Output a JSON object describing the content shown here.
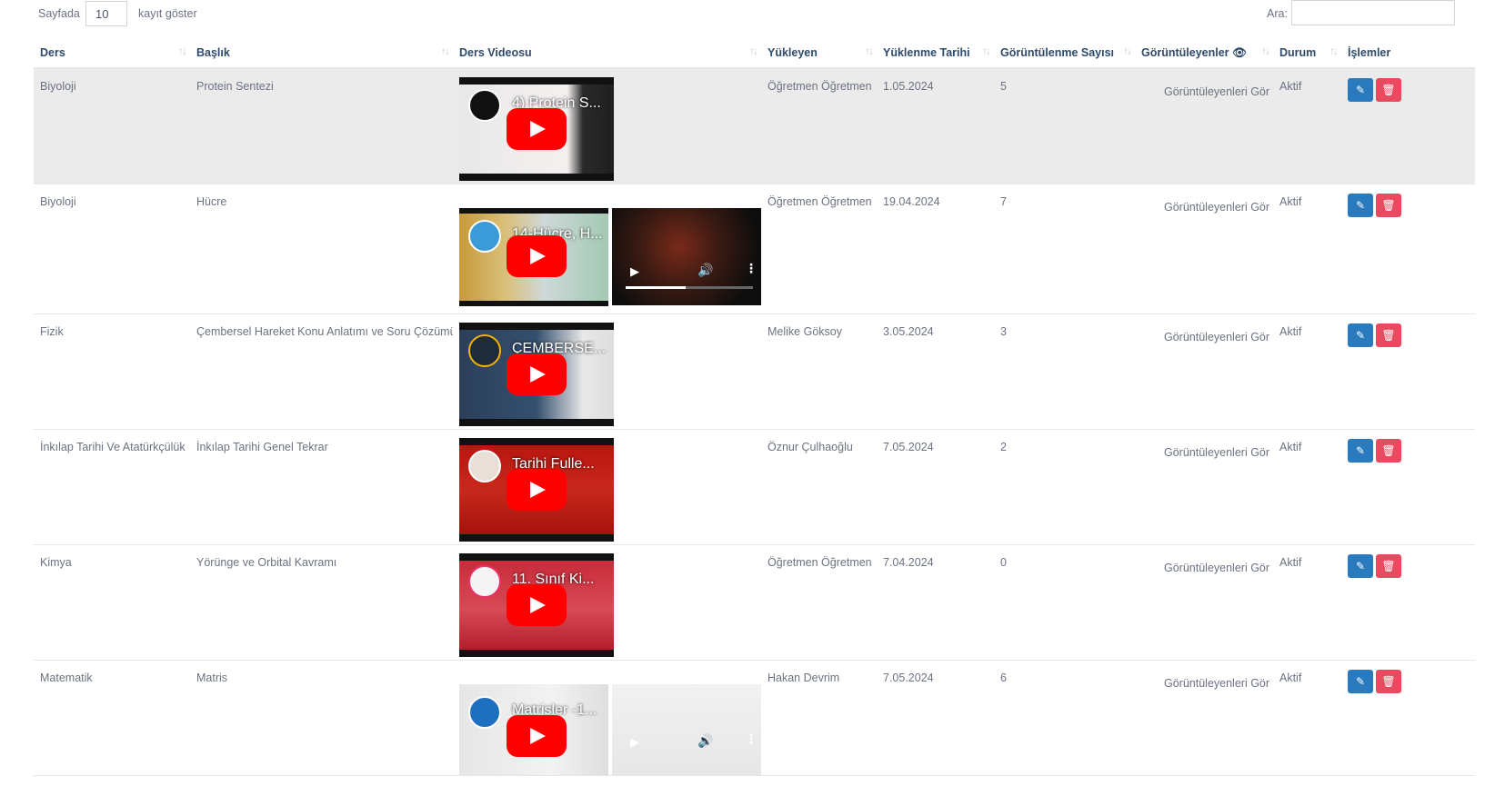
{
  "length_control": {
    "prefix": "Sayfada",
    "value": "10",
    "suffix": "kayıt göster"
  },
  "search": {
    "label": "Ara:",
    "value": ""
  },
  "columns": [
    "Ders",
    "Başlık",
    "Ders Videosu",
    "Yükleyen",
    "Yüklenme Tarihi",
    "Görüntülenme Sayısı",
    "Görüntüleyenler 👁",
    "Durum",
    "İşlemler"
  ],
  "sort_glyph": "↑↓",
  "viewers_link_label": "Görüntüleyenleri Gör",
  "icons": {
    "edit": "edit-icon",
    "delete": "trash-icon",
    "play": "play-icon",
    "volume": "volume-icon",
    "more": "more-vertical-icon"
  },
  "colors": {
    "header_text": "#2d4a6b",
    "edit_button": "#2a7bbd",
    "delete_button": "#e84a5f",
    "youtube_red": "#ff0000",
    "row_highlight": "#ebebeb"
  },
  "rows": [
    {
      "ders": "Biyoloji",
      "baslik": "Protein Sentezi",
      "video_titles": [
        "4) Protein S..."
      ],
      "has_player": false,
      "yukleyen": "Öğretmen Öğretmen",
      "tarih": "1.05.2024",
      "goruntulenme": "5",
      "durum": "Aktif"
    },
    {
      "ders": "Biyoloji",
      "baslik": "Hücre",
      "video_titles": [
        "14-Hücre, H..."
      ],
      "has_player": true,
      "player_progress": 0.47,
      "yukleyen": "Öğretmen Öğretmen",
      "tarih": "19.04.2024",
      "goruntulenme": "7",
      "durum": "Aktif"
    },
    {
      "ders": "Fizik",
      "baslik": "Çembersel Hareket Konu Anlatımı ve Soru Çözümü",
      "video_titles": [
        "ÇEMBERSE..."
      ],
      "has_player": false,
      "yukleyen": "Melike Göksoy",
      "tarih": "3.05.2024",
      "goruntulenme": "3",
      "durum": "Aktif"
    },
    {
      "ders": "İnkılap Tarihi Ve Atatürkçülük",
      "baslik": "İnkılap Tarihi Genel Tekrar",
      "video_titles": [
        "Tarihi Fulle..."
      ],
      "has_player": false,
      "yukleyen": "Öznur Çulhaoğlu",
      "tarih": "7.05.2024",
      "goruntulenme": "2",
      "durum": "Aktif"
    },
    {
      "ders": "Kimya",
      "baslik": "Yörünge ve Orbital Kavramı",
      "video_titles": [
        "11. Sınıf Ki..."
      ],
      "has_player": false,
      "yukleyen": "Öğretmen Öğretmen",
      "tarih": "7.04.2024",
      "goruntulenme": "0",
      "durum": "Aktif"
    },
    {
      "ders": "Matematik",
      "baslik": "Matris",
      "video_titles": [
        "Matrisler -1..."
      ],
      "has_player": true,
      "player_progress": 0,
      "yukleyen": "Hakan Devrim",
      "tarih": "7.05.2024",
      "goruntulenme": "6",
      "durum": "Aktif"
    }
  ]
}
